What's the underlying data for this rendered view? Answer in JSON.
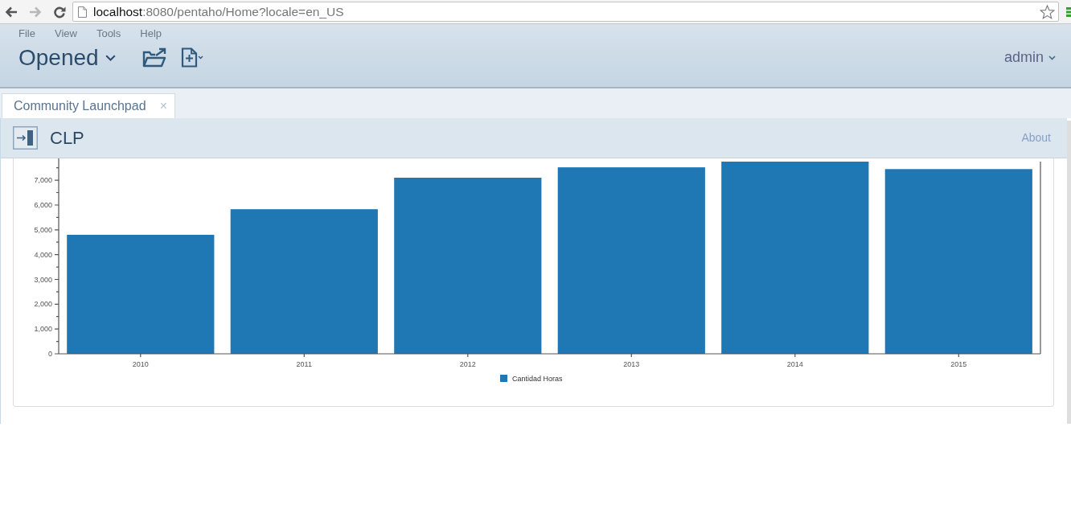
{
  "browser": {
    "nav_buttons": [
      {
        "kind": "back",
        "disabled": false
      },
      {
        "kind": "forward",
        "disabled": true
      },
      {
        "kind": "reload",
        "disabled": false
      }
    ],
    "address": {
      "host": "localhost",
      "path": ":8080/pentaho/Home?locale=en_US"
    }
  },
  "menu_bar": {
    "items": [
      "File",
      "View",
      "Tools",
      "Help"
    ]
  },
  "toolbar": {
    "perspective": "Opened",
    "user": "admin"
  },
  "tabs": [
    {
      "label": "Community Launchpad",
      "close": "×",
      "selected": true
    }
  ],
  "dashboard": {
    "title": "CLP",
    "link": "About",
    "chart_data": {
      "type": "bar",
      "categories": [
        "2010",
        "2011",
        "2012",
        "2013",
        "2014",
        "2015"
      ],
      "series": [
        {
          "name": "Cantidad Horas",
          "color": "#1f77b4",
          "values": [
            4800,
            5830,
            7100,
            7520,
            7750,
            7450
          ]
        }
      ],
      "ylim": [
        0,
        7750
      ],
      "yticks": [
        {
          "value": 0,
          "label": "0"
        },
        {
          "value": 1000,
          "label": "1,000"
        },
        {
          "value": 2000,
          "label": "2,000"
        },
        {
          "value": 3000,
          "label": "3,000"
        },
        {
          "value": 4000,
          "label": "4,000"
        },
        {
          "value": 5000,
          "label": "5,000"
        },
        {
          "value": 6000,
          "label": "6,000"
        },
        {
          "value": 7000,
          "label": "7,000"
        }
      ]
    }
  }
}
